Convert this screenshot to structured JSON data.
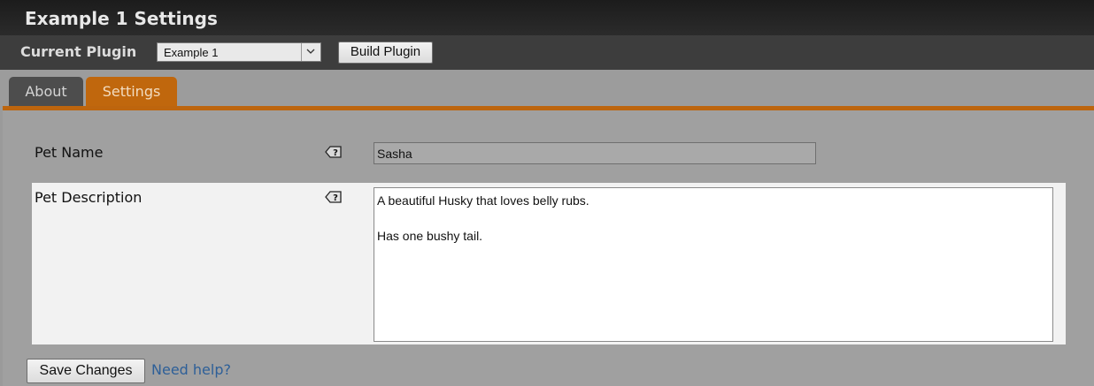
{
  "titlebar": {
    "title": "Example 1 Settings"
  },
  "pluginbar": {
    "label": "Current Plugin",
    "select_value": "Example 1",
    "build_label": "Build Plugin"
  },
  "tabs": [
    {
      "label": "About",
      "active": false
    },
    {
      "label": "Settings",
      "active": true
    }
  ],
  "form": {
    "pet_name_label": "Pet Name",
    "pet_name_value": "Sasha",
    "pet_description_label": "Pet Description",
    "pet_description_lines": [
      "A beautiful Husky that loves belly rubs.",
      "",
      "Has one bushy tail."
    ],
    "help_icon": "help-tag-icon"
  },
  "footer": {
    "save_label": "Save Changes",
    "help_link": "Need help?"
  },
  "colors": {
    "accent": "#c0670d",
    "title_bg": "#1c1c1c",
    "link": "#2d5f98"
  }
}
